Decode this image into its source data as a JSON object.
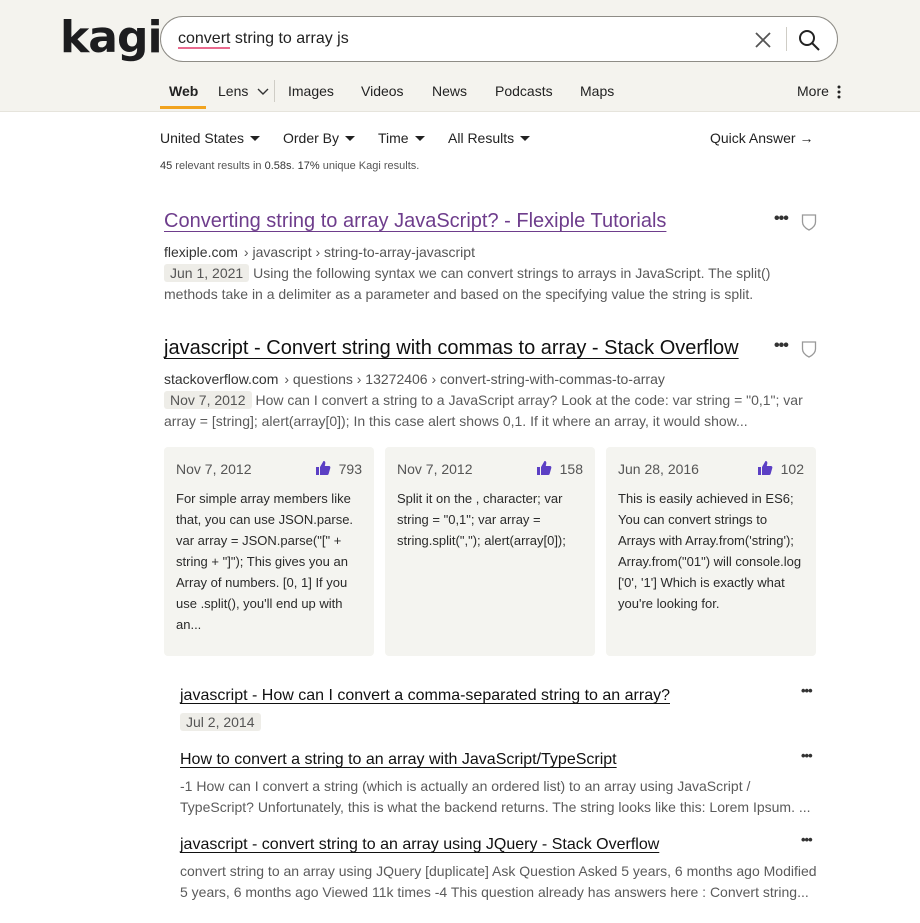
{
  "header": {
    "logo": "kagi",
    "search": {
      "query_misspelled": "convert",
      "query_rest": " string to array js"
    },
    "tabs": [
      {
        "label": "Web"
      },
      {
        "label": "Lens"
      },
      {
        "label": "Images"
      },
      {
        "label": "Videos"
      },
      {
        "label": "News"
      },
      {
        "label": "Podcasts"
      },
      {
        "label": "Maps"
      },
      {
        "label": "More"
      }
    ]
  },
  "filters": {
    "region": "United States",
    "order": "Order By",
    "time": "Time",
    "results": "All Results",
    "quick_answer": "Quick Answer →"
  },
  "stats": {
    "count": "45",
    "text1": " relevant results in ",
    "time": "0.58s",
    "text2": ". ",
    "unique": "17%",
    "text3": " unique Kagi results."
  },
  "results": [
    {
      "title": "Converting string to array JavaScript? - Flexiple Tutorials",
      "domain": "flexiple.com",
      "path": "› javascript › string-to-array-javascript",
      "date": "Jun 1, 2021",
      "snippet_line1": "Using the following syntax we can convert strings to arrays in JavaScript. The split()",
      "snippet_line2": "methods take in a delimiter as a parameter and based on the specifying value the string is split."
    },
    {
      "title": "javascript - Convert string with commas to array - Stack Overflow",
      "domain": "stackoverflow.com",
      "path": "› questions › 13272406 › convert-string-with-commas-to-array",
      "date": "Nov 7, 2012",
      "snippet_line1": "How can I convert a string to a JavaScript array? Look at the code: var string = \"0,1\"; var",
      "snippet_line2": "array = [string]; alert(array[0]); In this case alert shows 0,1. If it where an array, it would show..."
    }
  ],
  "answers": [
    {
      "date": "Nov 7, 2012",
      "votes": "793",
      "text": "For simple array members like that, you can use JSON.parse. var array = JSON.parse(\"[\" + string + \"]\"); This gives you an Array of numbers. [0, 1] If you use .split(), you'll end up with an..."
    },
    {
      "date": "Nov 7, 2012",
      "votes": "158",
      "text": "Split it on the , character; var string = \"0,1\"; var array = string.split(\",\"); alert(array[0]);"
    },
    {
      "date": "Jun 28, 2016",
      "votes": "102",
      "text": "This is easily achieved in ES6; You can convert strings to Arrays with Array.from('string'); Array.from(\"01\") will console.log ['0', '1'] Which is exactly what you're looking for."
    }
  ],
  "subresults": [
    {
      "title": "javascript - How can I convert a comma-separated string to an array?",
      "date": "Jul 2, 2014"
    },
    {
      "title": "How to convert a string to an array with JavaScript/TypeScript",
      "line1": "-1 How can I convert a string (which is actually an ordered list) to an array using JavaScript /",
      "line2": "TypeScript? Unfortunately, this is what the backend returns. The string looks like this: Lorem Ipsum. ..."
    },
    {
      "title": "javascript - convert string to an array using JQuery - Stack Overflow",
      "line1": "convert string to an array using JQuery [duplicate] Ask Question Asked 5 years, 6 months ago Modified",
      "line2": "5 years, 6 months ago Viewed 11k times -4 This question already has answers here : Convert string..."
    }
  ],
  "colors": {
    "accent": "#f1a31f",
    "visited": "#6e3d8c",
    "thumb": "#5b3fc4",
    "background_header": "#f4f3ee"
  }
}
